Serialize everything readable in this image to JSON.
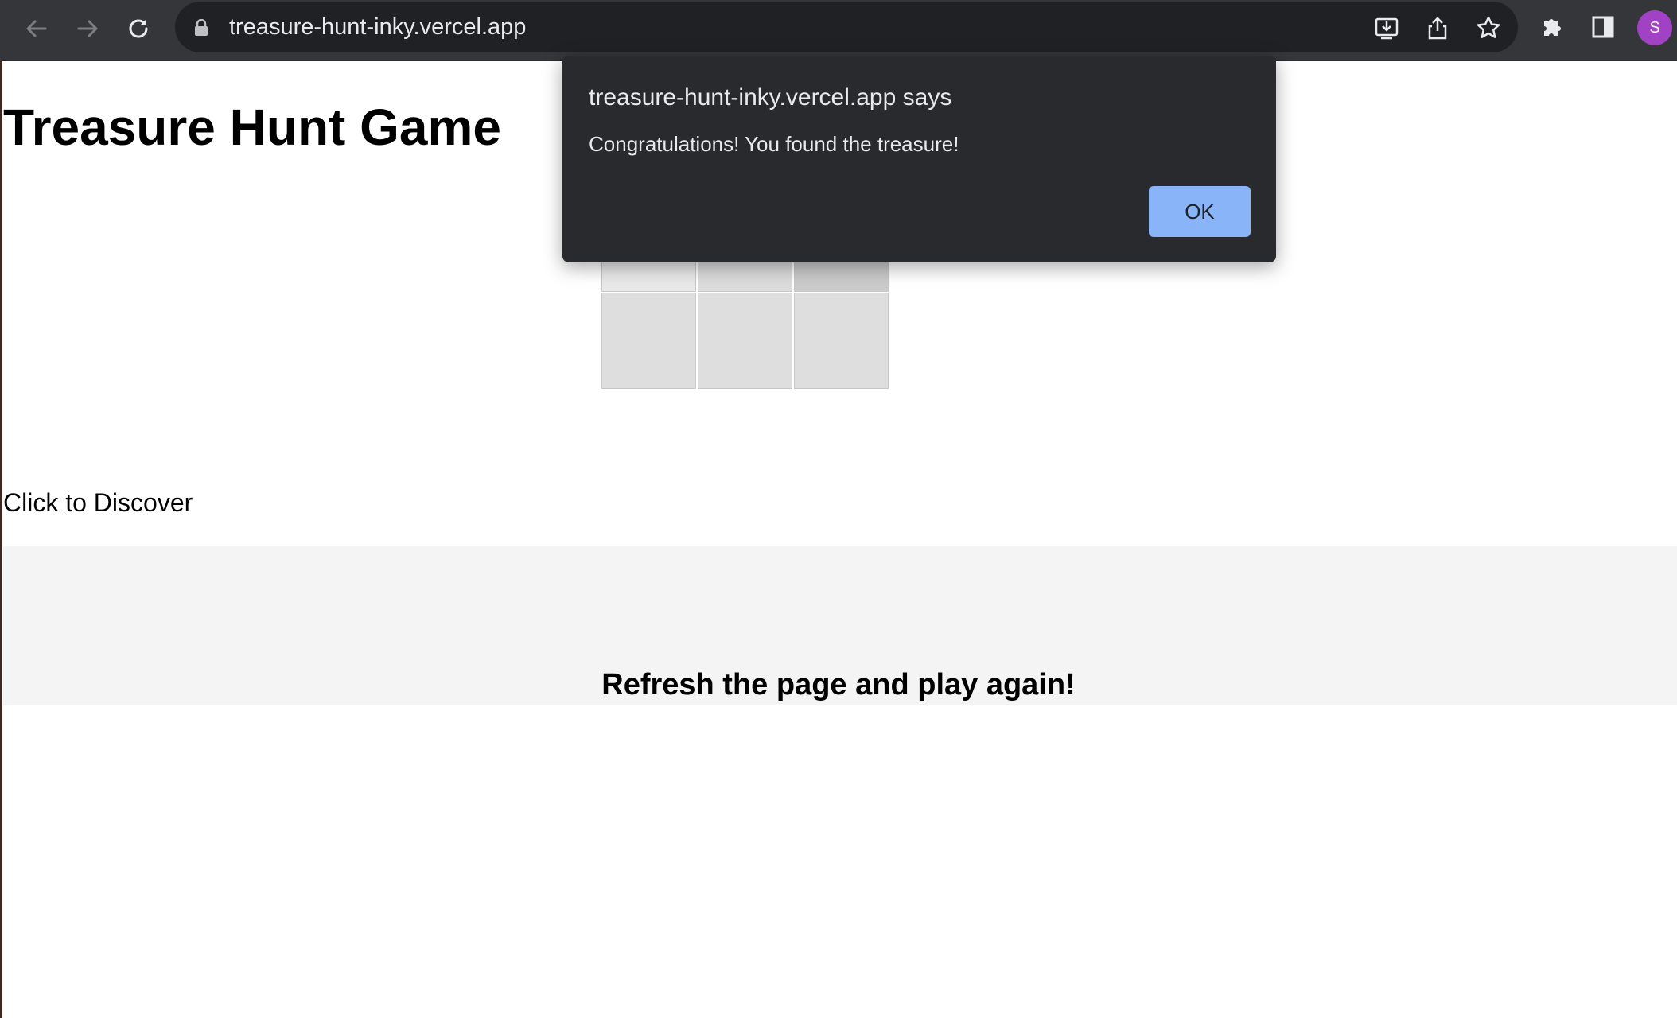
{
  "browser": {
    "url": "treasure-hunt-inky.vercel.app",
    "avatar_initial": "S",
    "icons": [
      "back-arrow-icon",
      "forward-arrow-icon",
      "reload-icon",
      "lock-icon",
      "install-icon",
      "share-icon",
      "bookmark-star-icon",
      "extensions-puzzle-icon",
      "side-panel-icon"
    ]
  },
  "page": {
    "title": "Treasure Hunt Game",
    "discover_label": "Click to Discover",
    "footer_message": "Refresh the page and play again!"
  },
  "grid": {
    "rows": 3,
    "cols": 3,
    "cell_colors": [
      [
        "#dcdcdc",
        "#e6e6e6",
        "#d6d6d6"
      ],
      [
        "#e9e9e9",
        "#dcdcdc",
        "#cbcbcb"
      ],
      [
        "#dedede",
        "#dedede",
        "#dedede"
      ]
    ]
  },
  "dialog": {
    "title": "treasure-hunt-inky.vercel.app says",
    "message": "Congratulations! You found the treasure!",
    "ok_label": "OK"
  },
  "colors": {
    "chrome_bg": "#35363a",
    "dialog_bg": "#292a2d",
    "ok_button": "#8ab4f8",
    "footer_bg": "#f4f4f4"
  }
}
